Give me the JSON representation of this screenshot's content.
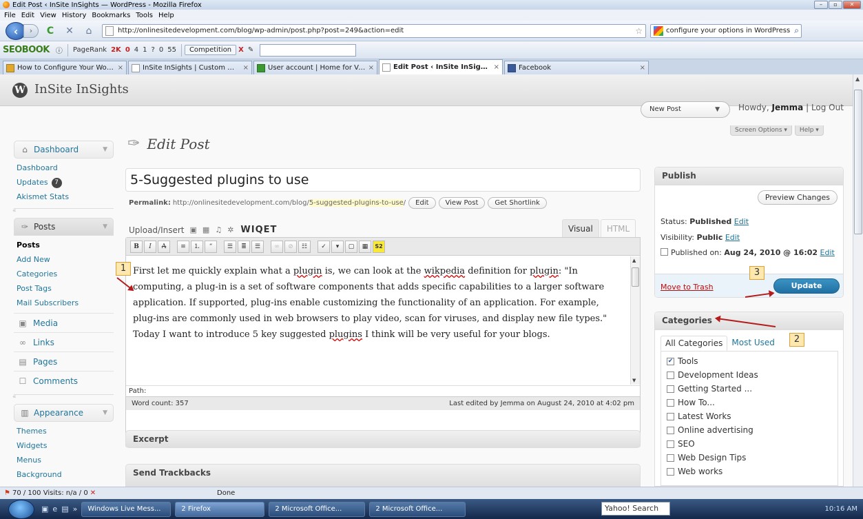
{
  "browser": {
    "window_title": "Edit Post ‹ InSite InSights — WordPress - Mozilla Firefox",
    "menu": [
      "File",
      "Edit",
      "View",
      "History",
      "Bookmarks",
      "Tools",
      "Help"
    ],
    "url": "http://onlinesitedevelopment.com/blog/wp-admin/post.php?post=249&action=edit",
    "search_value": "configure your options in WordPress",
    "tabs": [
      {
        "label": "How to Configure Your WordPress...",
        "close": "×"
      },
      {
        "label": "InSite InSights | Custom Web Desig...",
        "close": "×"
      },
      {
        "label": "User account | Home for Vajrayana...",
        "close": "×"
      },
      {
        "label": "Edit Post ‹ InSite InSights — Wor...",
        "close": "×"
      },
      {
        "label": "Facebook",
        "close": "×"
      }
    ],
    "status_text": "Done",
    "status_rank": "70 / 100",
    "status_visits": "Visits: n/a / 0"
  },
  "seobar": {
    "brand": "SEOBOOK",
    "pagerank": "PageRank",
    "stats": [
      "2K",
      "0",
      "4",
      "1",
      "?",
      "0",
      "55"
    ],
    "competition": "Competition"
  },
  "wp": {
    "site_name": "InSite InSights",
    "new_post": "New Post",
    "howdy_prefix": "Howdy,",
    "user": "Jemma",
    "log_out": "Log Out",
    "screen_options": "Screen Options ▾",
    "help": "Help ▾",
    "page_title": "Edit Post"
  },
  "sidebar": {
    "dashboard": {
      "label": "Dashboard",
      "items": [
        "Dashboard",
        "Updates",
        "Akismet Stats"
      ],
      "updates_count": "7"
    },
    "posts": {
      "label": "Posts",
      "items": [
        "Posts",
        "Add New",
        "Categories",
        "Post Tags",
        "Mail Subscribers"
      ]
    },
    "menus": [
      "Media",
      "Links",
      "Pages",
      "Comments"
    ],
    "appearance": {
      "label": "Appearance",
      "items": [
        "Themes",
        "Widgets",
        "Menus",
        "Background"
      ]
    }
  },
  "editor": {
    "title_value": "5-Suggested plugins to use",
    "permalink_label": "Permalink:",
    "permalink_base": "http://onlinesitedevelopment.com/blog/",
    "permalink_slug": "5-suggested-plugins-to-use",
    "permalink_trail": "/",
    "btn_edit": "Edit",
    "btn_view": "View Post",
    "btn_shortlink": "Get Shortlink",
    "upload_insert": "Upload/Insert",
    "wiget": "WIQET",
    "tab_visual": "Visual",
    "tab_html": "HTML",
    "para1_a": "First let me quickly explain what a ",
    "para1_plugin": "plugin",
    "para1_b": " is, we can look at the ",
    "para1_wikpedia": "wikpedia",
    "para1_c": " definition for ",
    "para1_plugin2": "plugin",
    "para1_d": ": \"In computing, a plug-in is a set of software components that adds specific capabilities to a larger software application. If supported, plug-ins enable customizing the functionality of an application. For example, plug-ins are commonly used in web browsers to play video, scan for viruses, and display new file types.\" Today I want to introduce 5 key suggested ",
    "para1_plugins": "plugins",
    "para1_e": " I think will be very useful for your blogs.",
    "path_label": "Path:",
    "word_count": "Word count: 357",
    "last_edited": "Last edited by Jemma on August 24, 2010 at 4:02 pm"
  },
  "boxes": {
    "excerpt": "Excerpt",
    "trackbacks": "Send Trackbacks"
  },
  "publish": {
    "title": "Publish",
    "preview": "Preview Changes",
    "status_label": "Status:",
    "status_value": "Published",
    "visibility_label": "Visibility:",
    "visibility_value": "Public",
    "published_label": "Published on:",
    "published_value": "Aug 24, 2010 @ 16:02",
    "edit": "Edit",
    "trash": "Move to Trash",
    "update": "Update"
  },
  "categories": {
    "title": "Categories",
    "tab_all": "All Categories",
    "tab_most": "Most Used",
    "items": [
      {
        "label": "Tools",
        "checked": true
      },
      {
        "label": "Development Ideas",
        "checked": false
      },
      {
        "label": "Getting Started ...",
        "checked": false
      },
      {
        "label": "How To...",
        "checked": false
      },
      {
        "label": "Latest Works",
        "checked": false
      },
      {
        "label": "Online advertising",
        "checked": false
      },
      {
        "label": "SEO",
        "checked": false
      },
      {
        "label": "Web Design Tips",
        "checked": false
      },
      {
        "label": "Web works",
        "checked": false
      }
    ]
  },
  "annotations": [
    "1",
    "2",
    "3"
  ],
  "taskbar": {
    "items": [
      "Windows Live Mess...",
      "2 Firefox",
      "2 Microsoft Office...",
      "2 Microsoft Office..."
    ],
    "yahoo": "Yahoo! Search",
    "clock": "10:16 AM"
  }
}
